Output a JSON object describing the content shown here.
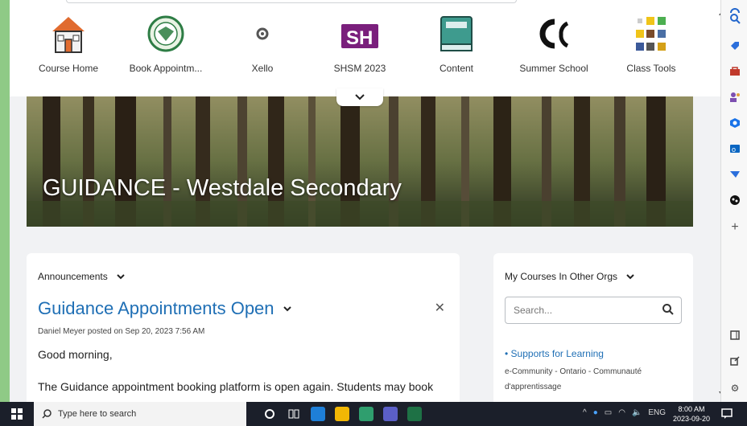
{
  "navbar": {
    "items": [
      {
        "label": "Course Home",
        "icon": "house-icon"
      },
      {
        "label": "Book Appointm...",
        "icon": "school-crest-icon"
      },
      {
        "label": "Xello",
        "icon": "xello-logo-icon"
      },
      {
        "label": "SHSM 2023",
        "icon": "shsm-logo-icon"
      },
      {
        "label": "Content",
        "icon": "book-icon"
      },
      {
        "label": "Summer School",
        "icon": "summer-school-logo-icon"
      },
      {
        "label": "Class Tools",
        "icon": "class-tools-grid-icon"
      }
    ]
  },
  "banner": {
    "title": "GUIDANCE - Westdale Secondary"
  },
  "announcements": {
    "header": "Announcements",
    "title": "Guidance Appointments Open",
    "meta": "Daniel Meyer posted on Sep 20, 2023 7:56 AM",
    "greeting": "Good morning,",
    "body": "The Guidance appointment booking platform is open again.  Students may book"
  },
  "my_courses": {
    "header": "My Courses In Other Orgs",
    "search_placeholder": "Search...",
    "link": "Supports for Learning",
    "description": "e-Community - Ontario - Communauté d'apprentissage"
  },
  "taskbar": {
    "search_placeholder": "Type here to search",
    "language": "ENG",
    "time": "8:00 AM",
    "date": "2023-09-20"
  },
  "colors": {
    "link": "#1f6fb5",
    "background": "#f1f2f4",
    "desktop": "#8fca86",
    "taskbar": "#1b1f2a"
  }
}
